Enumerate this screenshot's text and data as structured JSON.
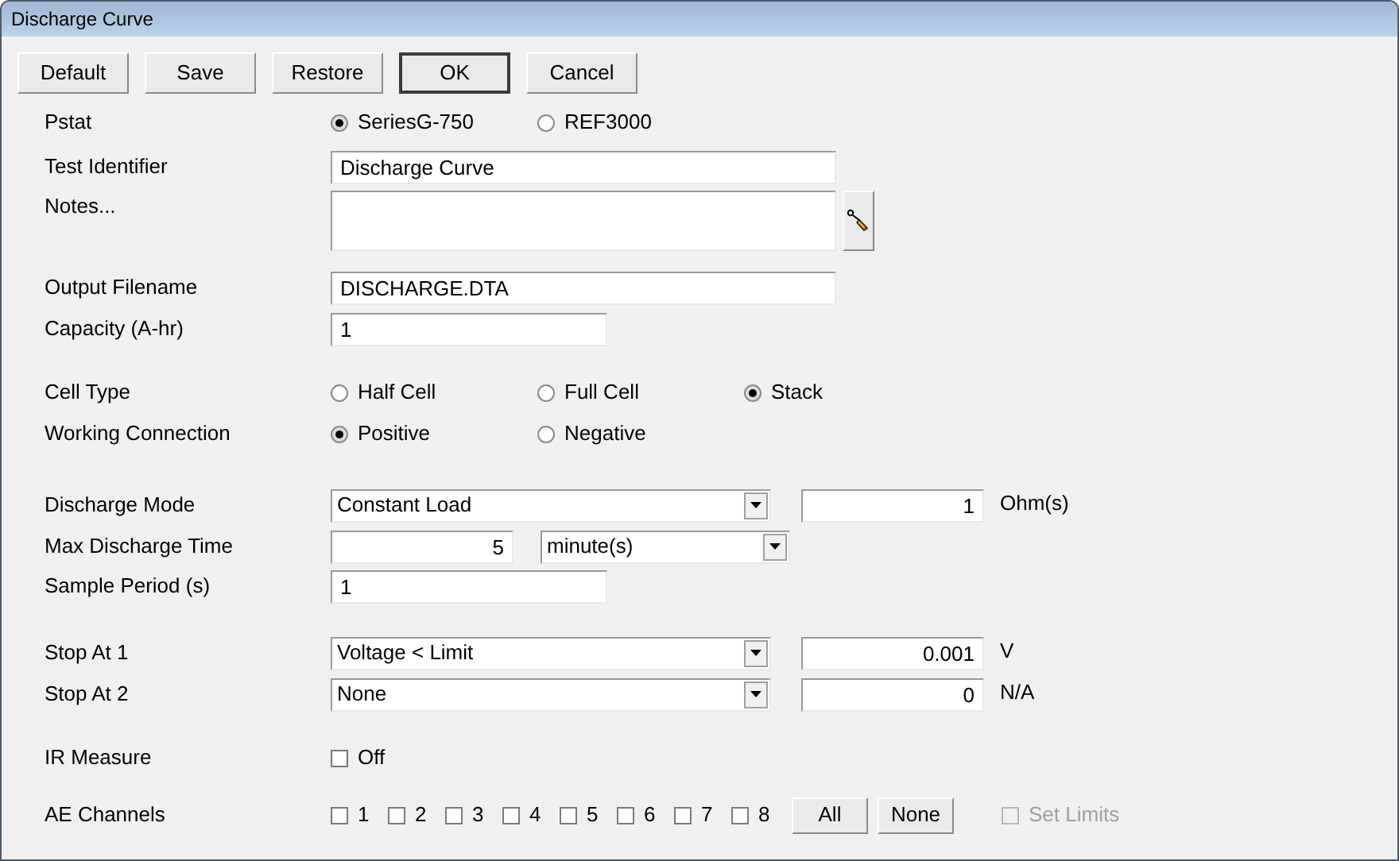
{
  "window": {
    "title": "Discharge Curve"
  },
  "buttons": [
    {
      "label": "Default",
      "default": false
    },
    {
      "label": "Save",
      "default": false
    },
    {
      "label": "Restore",
      "default": false
    },
    {
      "label": "OK",
      "default": true
    },
    {
      "label": "Cancel",
      "default": false
    }
  ],
  "pstat": {
    "label": "Pstat",
    "options": [
      {
        "label": "SeriesG-750",
        "selected": true
      },
      {
        "label": "REF3000",
        "selected": false
      }
    ]
  },
  "test_identifier": {
    "label": "Test Identifier",
    "value": "Discharge Curve"
  },
  "notes": {
    "label": "Notes..."
  },
  "output_filename": {
    "label": "Output Filename",
    "value": "DISCHARGE.DTA"
  },
  "capacity": {
    "label": "Capacity (A-hr)",
    "value": "1"
  },
  "cell_type": {
    "label": "Cell Type",
    "options": [
      {
        "label": "Half Cell",
        "selected": false
      },
      {
        "label": "Full Cell",
        "selected": false
      },
      {
        "label": "Stack",
        "selected": true
      }
    ]
  },
  "working_connection": {
    "label": "Working Connection",
    "options": [
      {
        "label": "Positive",
        "selected": true
      },
      {
        "label": "Negative",
        "selected": false
      }
    ]
  },
  "discharge_mode": {
    "label": "Discharge Mode",
    "value": "Constant Load",
    "amount": "1",
    "unit": "Ohm(s)"
  },
  "max_discharge_time": {
    "label": "Max Discharge Time",
    "value": "5",
    "unit": "minute(s)"
  },
  "sample_period": {
    "label": "Sample Period (s)",
    "value": "1"
  },
  "stop_at": [
    {
      "label": "Stop At 1",
      "value": "Voltage < Limit",
      "amount": "0.001",
      "unit": "V"
    },
    {
      "label": "Stop At 2",
      "value": "None",
      "amount": "0",
      "unit": "N/A"
    }
  ],
  "ir_measure": {
    "label": "IR Measure",
    "checkbox": {
      "label": "Off",
      "checked": false
    }
  },
  "ae_channels": {
    "label": "AE Channels",
    "channels": [
      {
        "label": "1",
        "checked": false
      },
      {
        "label": "2",
        "checked": false
      },
      {
        "label": "3",
        "checked": false
      },
      {
        "label": "4",
        "checked": false
      },
      {
        "label": "5",
        "checked": false
      },
      {
        "label": "6",
        "checked": false
      },
      {
        "label": "7",
        "checked": false
      },
      {
        "label": "8",
        "checked": false
      }
    ],
    "buttons": [
      {
        "label": "All"
      },
      {
        "label": "None"
      }
    ],
    "set_limits": {
      "label": "Set Limits",
      "checked": false,
      "disabled": true
    }
  }
}
